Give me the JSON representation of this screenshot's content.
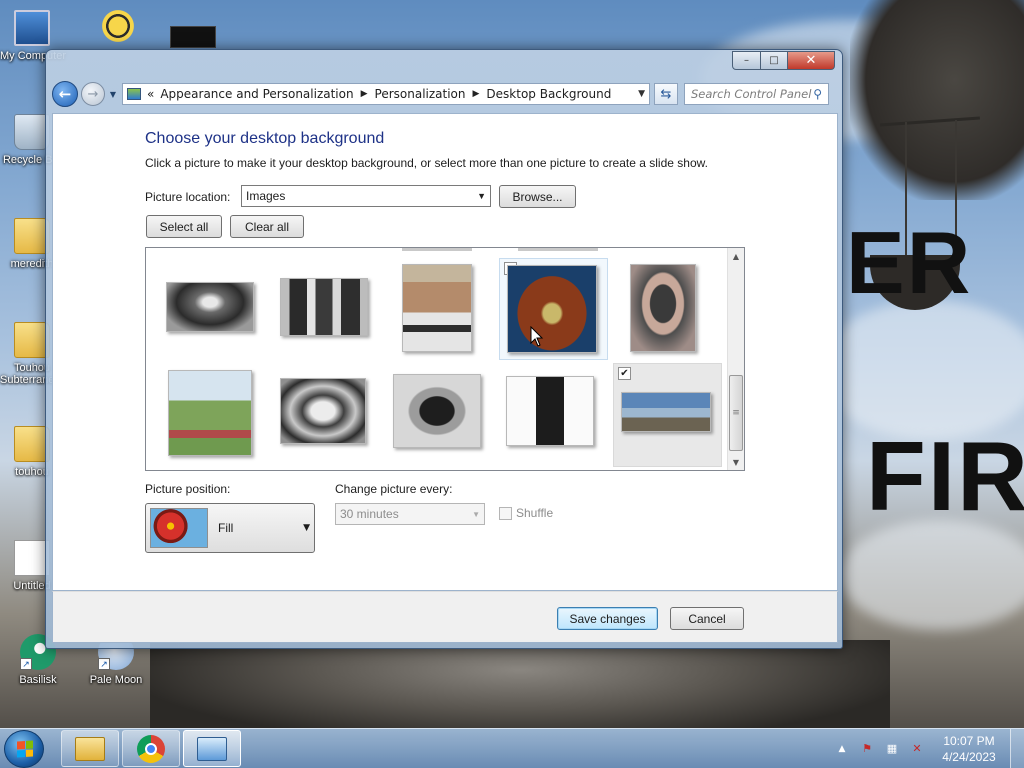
{
  "desktop": {
    "icons": [
      {
        "label": "My Computer",
        "icon": "computer-icon"
      },
      {
        "label": "Recycle Bin",
        "icon": "recycle-bin-icon"
      },
      {
        "label": "meredith",
        "icon": "folder-icon"
      },
      {
        "label": "Touhou Subterranean",
        "icon": "folder-icon"
      },
      {
        "label": "touhou",
        "icon": "folder-icon"
      },
      {
        "label": "Untitled",
        "icon": "image-file-icon"
      },
      {
        "label": "Basilisk",
        "icon": "basilisk-icon"
      },
      {
        "label": "Pale Moon",
        "icon": "pale-moon-icon"
      }
    ],
    "wallpaper_text": [
      "ER",
      "FIR"
    ]
  },
  "window": {
    "title_buttons": {
      "minimize": "–",
      "maximize": "□",
      "close": "✕"
    },
    "address": {
      "overflow": "«",
      "crumbs": [
        "Appearance and Personalization",
        "Personalization",
        "Desktop Background"
      ],
      "separator": "▶"
    },
    "search_placeholder": "Search Control Panel",
    "heading": "Choose your desktop background",
    "subheading": "Click a picture to make it your desktop background, or select more than one picture to create a slide show.",
    "picture_location": {
      "label": "Picture location:",
      "value": "Images"
    },
    "browse_label": "Browse...",
    "select_all_label": "Select all",
    "clear_all_label": "Clear all",
    "thumbnails": [
      {
        "name": "thumb-1",
        "checked": false
      },
      {
        "name": "thumb-2",
        "checked": false
      },
      {
        "name": "thumb-3",
        "checked": false
      },
      {
        "name": "thumb-4",
        "checked": false
      },
      {
        "name": "thumb-5",
        "checked": false
      },
      {
        "name": "thumb-6",
        "checked": false
      },
      {
        "name": "thumb-7",
        "checked": false
      },
      {
        "name": "thumb-8",
        "checked": false
      },
      {
        "name": "thumb-9",
        "checked": false
      },
      {
        "name": "thumb-10",
        "checked": true
      }
    ],
    "picture_position": {
      "label": "Picture position:",
      "value": "Fill"
    },
    "change_picture": {
      "label": "Change picture every:",
      "value": "30 minutes"
    },
    "shuffle_label": "Shuffle",
    "save_label": "Save changes",
    "cancel_label": "Cancel"
  },
  "taskbar": {
    "clock_time": "10:07 PM",
    "clock_date": "4/24/2023",
    "tray_expand": "▲"
  }
}
